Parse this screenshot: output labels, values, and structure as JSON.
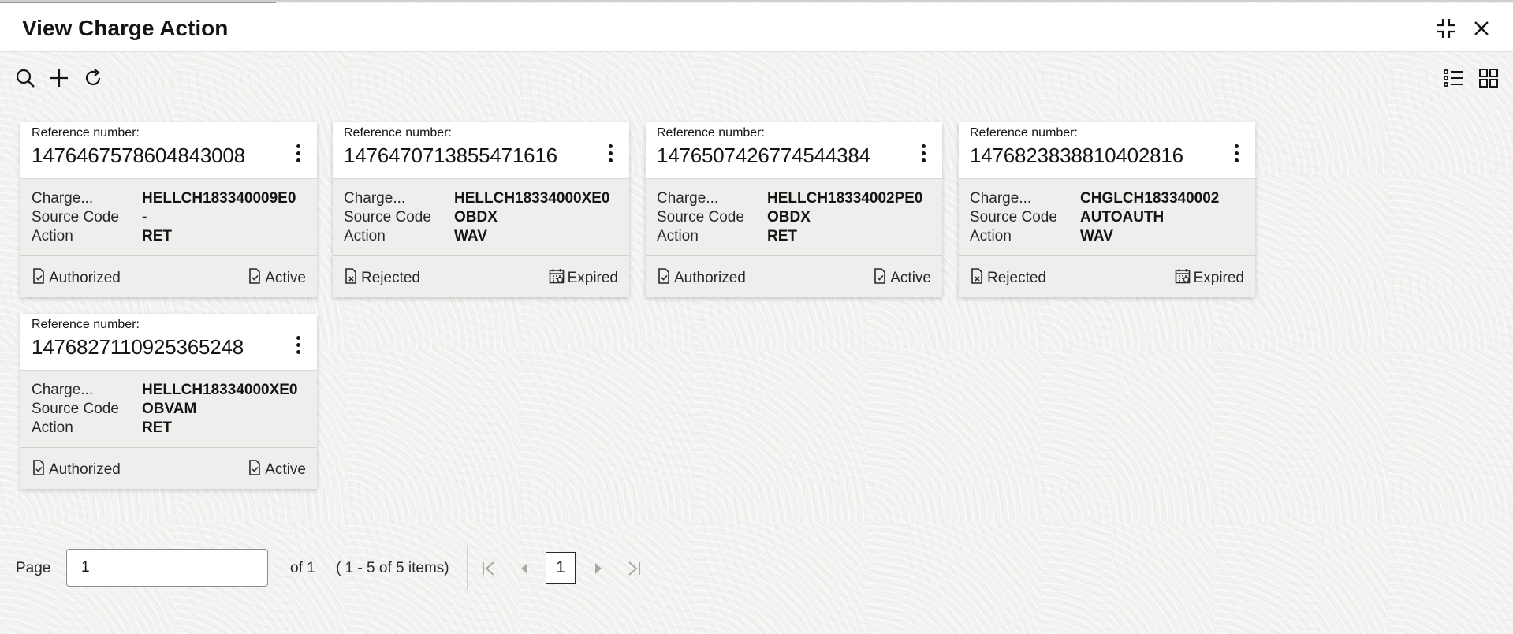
{
  "window": {
    "title": "View Charge Action"
  },
  "header_icons": [
    "minimize-icon",
    "close-icon"
  ],
  "toolbar_icons": [
    "search-icon",
    "add-icon",
    "refresh-icon",
    "list-view-icon",
    "tile-view-icon"
  ],
  "cards": [
    {
      "ref_label": "Reference number:",
      "ref_number": "1476467578604843008",
      "rows": [
        {
          "label": "Charge...",
          "value": "HELLCH183340009E0"
        },
        {
          "label": "Source Code",
          "value": "-"
        },
        {
          "label": "Action",
          "value": "RET"
        }
      ],
      "status_left": {
        "label": "Authorized",
        "icon": "authorized-icon"
      },
      "status_right": {
        "label": "Active",
        "icon": "active-icon"
      }
    },
    {
      "ref_label": "Reference number:",
      "ref_number": "1476470713855471616",
      "rows": [
        {
          "label": "Charge...",
          "value": "HELLCH18334000XE0"
        },
        {
          "label": "Source Code",
          "value": "OBDX"
        },
        {
          "label": "Action",
          "value": "WAV"
        }
      ],
      "status_left": {
        "label": "Rejected",
        "icon": "rejected-icon"
      },
      "status_right": {
        "label": "Expired",
        "icon": "expired-calendar-icon"
      }
    },
    {
      "ref_label": "Reference number:",
      "ref_number": "1476507426774544384",
      "rows": [
        {
          "label": "Charge...",
          "value": "HELLCH18334002PE0"
        },
        {
          "label": "Source Code",
          "value": "OBDX"
        },
        {
          "label": "Action",
          "value": "RET"
        }
      ],
      "status_left": {
        "label": "Authorized",
        "icon": "authorized-icon"
      },
      "status_right": {
        "label": "Active",
        "icon": "active-icon"
      }
    },
    {
      "ref_label": "Reference number:",
      "ref_number": "1476823838810402816",
      "rows": [
        {
          "label": "Charge...",
          "value": "CHGLCH183340002"
        },
        {
          "label": "Source Code",
          "value": "AUTOAUTH"
        },
        {
          "label": "Action",
          "value": "WAV"
        }
      ],
      "status_left": {
        "label": "Rejected",
        "icon": "rejected-icon"
      },
      "status_right": {
        "label": "Expired",
        "icon": "expired-calendar-icon"
      }
    },
    {
      "ref_label": "Reference number:",
      "ref_number": "1476827110925365248",
      "rows": [
        {
          "label": "Charge...",
          "value": "HELLCH18334000XE0"
        },
        {
          "label": "Source Code",
          "value": "OBVAM"
        },
        {
          "label": "Action",
          "value": "RET"
        }
      ],
      "status_left": {
        "label": "Authorized",
        "icon": "authorized-icon"
      },
      "status_right": {
        "label": "Active",
        "icon": "active-icon"
      }
    }
  ],
  "pagination": {
    "page_label": "Page",
    "page_value": "1",
    "of_text": "of 1",
    "items_text": "( 1 - 5 of 5 items)",
    "current_page": "1"
  }
}
